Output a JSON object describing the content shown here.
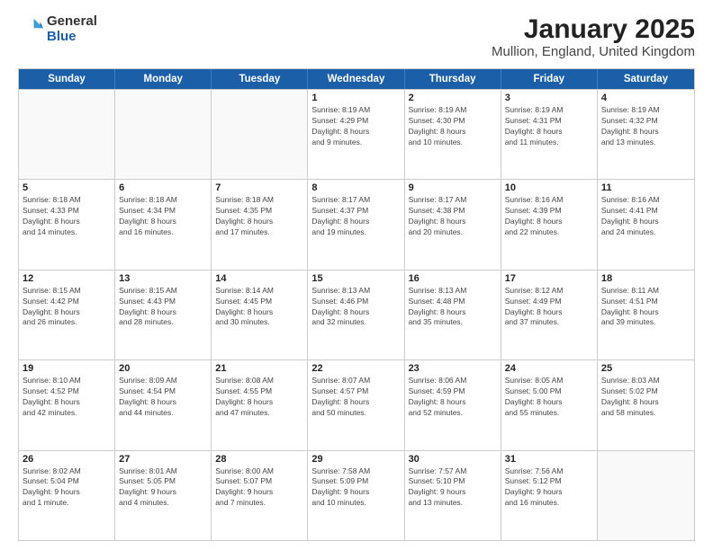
{
  "logo": {
    "general": "General",
    "blue": "Blue"
  },
  "title": "January 2025",
  "subtitle": "Mullion, England, United Kingdom",
  "days": [
    "Sunday",
    "Monday",
    "Tuesday",
    "Wednesday",
    "Thursday",
    "Friday",
    "Saturday"
  ],
  "weeks": [
    [
      {
        "day": "",
        "info": ""
      },
      {
        "day": "",
        "info": ""
      },
      {
        "day": "",
        "info": ""
      },
      {
        "day": "1",
        "info": "Sunrise: 8:19 AM\nSunset: 4:29 PM\nDaylight: 8 hours\nand 9 minutes."
      },
      {
        "day": "2",
        "info": "Sunrise: 8:19 AM\nSunset: 4:30 PM\nDaylight: 8 hours\nand 10 minutes."
      },
      {
        "day": "3",
        "info": "Sunrise: 8:19 AM\nSunset: 4:31 PM\nDaylight: 8 hours\nand 11 minutes."
      },
      {
        "day": "4",
        "info": "Sunrise: 8:19 AM\nSunset: 4:32 PM\nDaylight: 8 hours\nand 13 minutes."
      }
    ],
    [
      {
        "day": "5",
        "info": "Sunrise: 8:18 AM\nSunset: 4:33 PM\nDaylight: 8 hours\nand 14 minutes."
      },
      {
        "day": "6",
        "info": "Sunrise: 8:18 AM\nSunset: 4:34 PM\nDaylight: 8 hours\nand 16 minutes."
      },
      {
        "day": "7",
        "info": "Sunrise: 8:18 AM\nSunset: 4:35 PM\nDaylight: 8 hours\nand 17 minutes."
      },
      {
        "day": "8",
        "info": "Sunrise: 8:17 AM\nSunset: 4:37 PM\nDaylight: 8 hours\nand 19 minutes."
      },
      {
        "day": "9",
        "info": "Sunrise: 8:17 AM\nSunset: 4:38 PM\nDaylight: 8 hours\nand 20 minutes."
      },
      {
        "day": "10",
        "info": "Sunrise: 8:16 AM\nSunset: 4:39 PM\nDaylight: 8 hours\nand 22 minutes."
      },
      {
        "day": "11",
        "info": "Sunrise: 8:16 AM\nSunset: 4:41 PM\nDaylight: 8 hours\nand 24 minutes."
      }
    ],
    [
      {
        "day": "12",
        "info": "Sunrise: 8:15 AM\nSunset: 4:42 PM\nDaylight: 8 hours\nand 26 minutes."
      },
      {
        "day": "13",
        "info": "Sunrise: 8:15 AM\nSunset: 4:43 PM\nDaylight: 8 hours\nand 28 minutes."
      },
      {
        "day": "14",
        "info": "Sunrise: 8:14 AM\nSunset: 4:45 PM\nDaylight: 8 hours\nand 30 minutes."
      },
      {
        "day": "15",
        "info": "Sunrise: 8:13 AM\nSunset: 4:46 PM\nDaylight: 8 hours\nand 32 minutes."
      },
      {
        "day": "16",
        "info": "Sunrise: 8:13 AM\nSunset: 4:48 PM\nDaylight: 8 hours\nand 35 minutes."
      },
      {
        "day": "17",
        "info": "Sunrise: 8:12 AM\nSunset: 4:49 PM\nDaylight: 8 hours\nand 37 minutes."
      },
      {
        "day": "18",
        "info": "Sunrise: 8:11 AM\nSunset: 4:51 PM\nDaylight: 8 hours\nand 39 minutes."
      }
    ],
    [
      {
        "day": "19",
        "info": "Sunrise: 8:10 AM\nSunset: 4:52 PM\nDaylight: 8 hours\nand 42 minutes."
      },
      {
        "day": "20",
        "info": "Sunrise: 8:09 AM\nSunset: 4:54 PM\nDaylight: 8 hours\nand 44 minutes."
      },
      {
        "day": "21",
        "info": "Sunrise: 8:08 AM\nSunset: 4:55 PM\nDaylight: 8 hours\nand 47 minutes."
      },
      {
        "day": "22",
        "info": "Sunrise: 8:07 AM\nSunset: 4:57 PM\nDaylight: 8 hours\nand 50 minutes."
      },
      {
        "day": "23",
        "info": "Sunrise: 8:06 AM\nSunset: 4:59 PM\nDaylight: 8 hours\nand 52 minutes."
      },
      {
        "day": "24",
        "info": "Sunrise: 8:05 AM\nSunset: 5:00 PM\nDaylight: 8 hours\nand 55 minutes."
      },
      {
        "day": "25",
        "info": "Sunrise: 8:03 AM\nSunset: 5:02 PM\nDaylight: 8 hours\nand 58 minutes."
      }
    ],
    [
      {
        "day": "26",
        "info": "Sunrise: 8:02 AM\nSunset: 5:04 PM\nDaylight: 9 hours\nand 1 minute."
      },
      {
        "day": "27",
        "info": "Sunrise: 8:01 AM\nSunset: 5:05 PM\nDaylight: 9 hours\nand 4 minutes."
      },
      {
        "day": "28",
        "info": "Sunrise: 8:00 AM\nSunset: 5:07 PM\nDaylight: 9 hours\nand 7 minutes."
      },
      {
        "day": "29",
        "info": "Sunrise: 7:58 AM\nSunset: 5:09 PM\nDaylight: 9 hours\nand 10 minutes."
      },
      {
        "day": "30",
        "info": "Sunrise: 7:57 AM\nSunset: 5:10 PM\nDaylight: 9 hours\nand 13 minutes."
      },
      {
        "day": "31",
        "info": "Sunrise: 7:56 AM\nSunset: 5:12 PM\nDaylight: 9 hours\nand 16 minutes."
      },
      {
        "day": "",
        "info": ""
      }
    ]
  ]
}
